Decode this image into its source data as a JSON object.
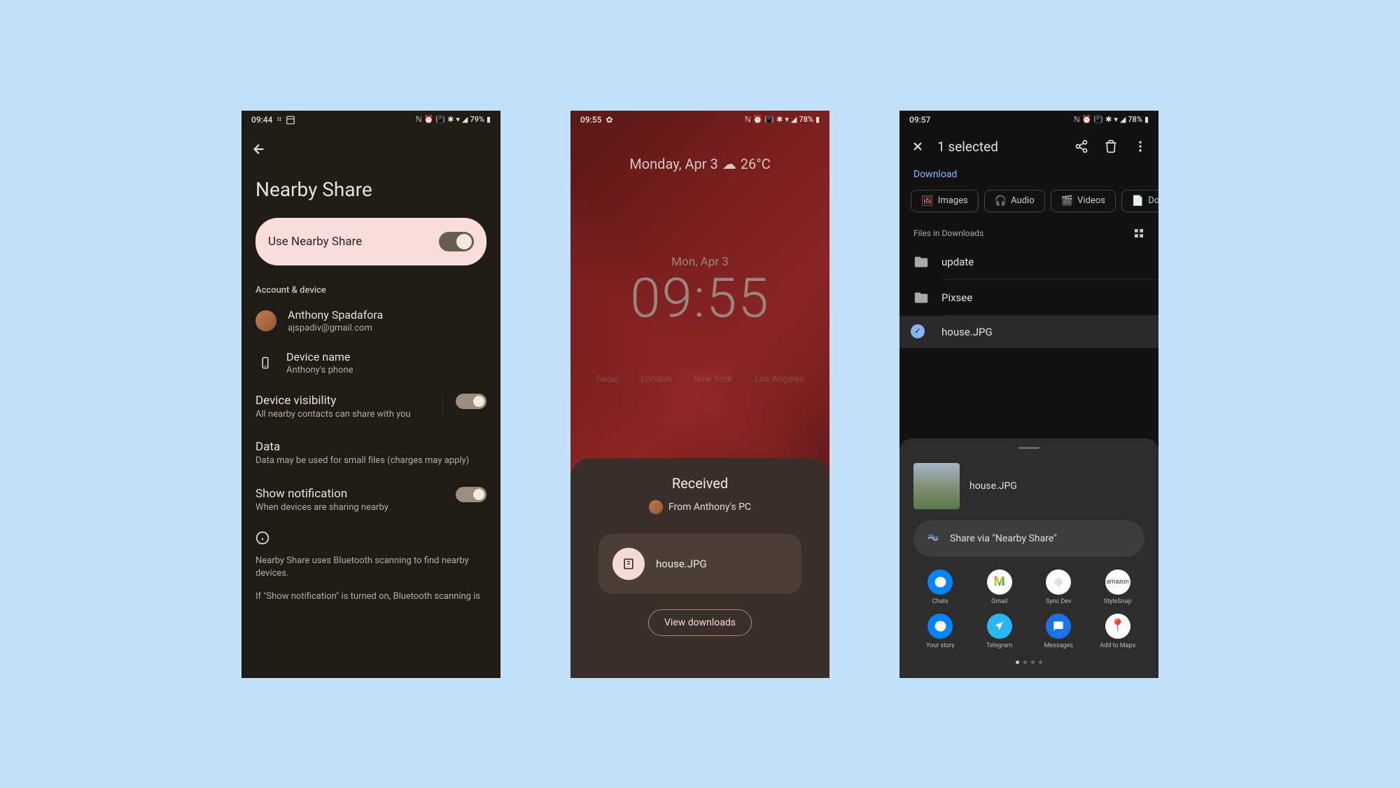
{
  "phone1": {
    "status": {
      "time": "09:44",
      "battery": "79%"
    },
    "title": "Nearby Share",
    "toggle_label": "Use Nearby Share",
    "section_account": "Account & device",
    "account": {
      "name": "Anthony Spadafora",
      "email": "ajspadiv@gmail.com"
    },
    "device": {
      "label": "Device name",
      "value": "Anthony's phone"
    },
    "visibility": {
      "title": "Device visibility",
      "sub": "All nearby contacts can share with you"
    },
    "data": {
      "title": "Data",
      "sub": "Data may be used for small files (charges may apply)"
    },
    "notif": {
      "title": "Show notification",
      "sub": "When devices are sharing nearby"
    },
    "info1": "Nearby Share uses Bluetooth scanning to find nearby devices.",
    "info2": "If \"Show notification\" is turned on, Bluetooth scanning is"
  },
  "phone2": {
    "status": {
      "time": "09:55",
      "battery": "78%"
    },
    "date_full": "Monday, Apr 3",
    "temp": "26°C",
    "date_short": "Mon, Apr 3",
    "clock": "09:55",
    "cities": [
      "Seoul",
      "London",
      "New York",
      "Los Angeles"
    ],
    "received_title": "Received",
    "from_label": "From Anthony's PC",
    "file_name": "house.JPG",
    "view_btn": "View downloads"
  },
  "phone3": {
    "status": {
      "time": "09:57",
      "battery": "78%"
    },
    "header_title": "1 selected",
    "breadcrumb": "Download",
    "chips": [
      "Images",
      "Audio",
      "Videos",
      "Docum"
    ],
    "section_label": "Files in Downloads",
    "items": [
      "update",
      "Pixsee",
      "house.JPG"
    ],
    "sheet_filename": "house.JPG",
    "nearby_share_label": "Share via \"Nearby Share\"",
    "apps_row1": [
      "Chats",
      "Gmail",
      "Sync Dev",
      "StyleSnap"
    ],
    "apps_row2": [
      "Your story",
      "Telegram",
      "Messages",
      "Add to Maps"
    ]
  }
}
